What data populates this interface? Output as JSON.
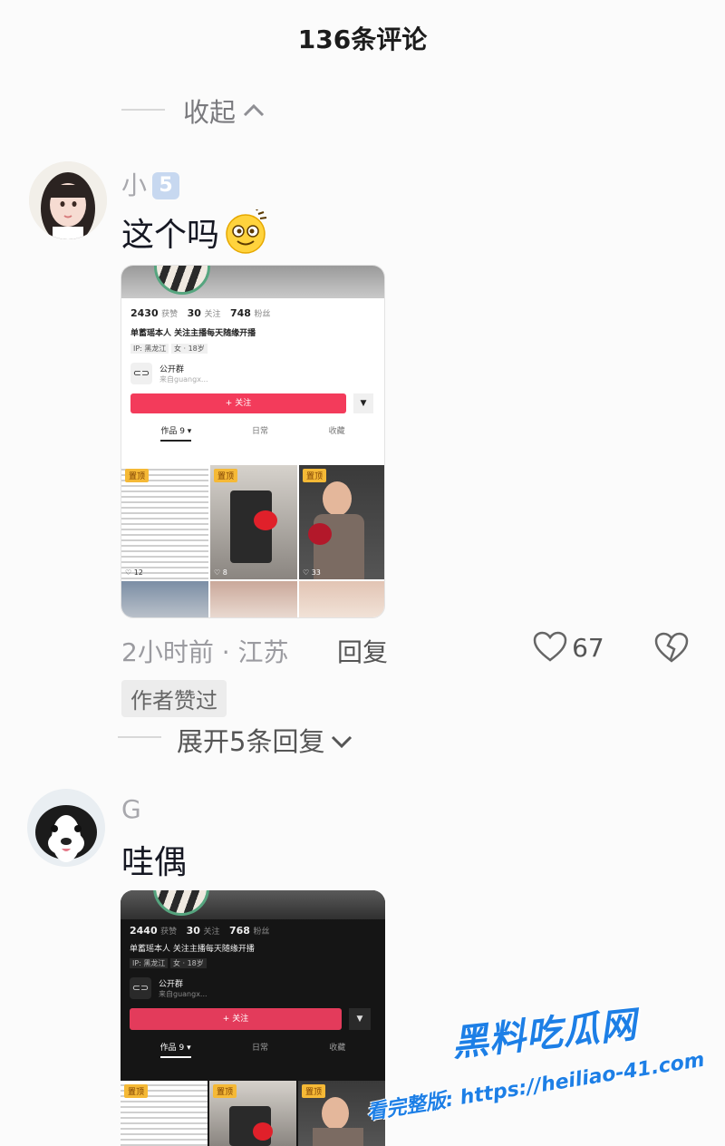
{
  "header": {
    "title": "136条评论"
  },
  "collapse": {
    "label": "收起"
  },
  "comments": [
    {
      "user": "小",
      "level": "5",
      "text": "这个吗",
      "time_location": "2小时前 · 江苏",
      "reply_label": "回复",
      "likes": "67",
      "author_liked_badge": "作者赞过",
      "expand_label": "展开5条回复",
      "screenshot": {
        "stats": [
          {
            "num": "2430",
            "label": "获赞"
          },
          {
            "num": "30",
            "label": "关注"
          },
          {
            "num": "748",
            "label": "粉丝"
          }
        ],
        "bio": "单蓄瑶本人 关注主播每天随缘开播",
        "ip": "IP: 黑龙江",
        "gender_age": "女 · 18岁",
        "group_title": "公开群",
        "group_sub": "来自guangx...",
        "follow_label": "+ 关注",
        "tabs": [
          "作品 9 ▾",
          "日常",
          "收藏"
        ],
        "tile_tag": "置顶",
        "tile_counts": [
          "12",
          "8",
          "33"
        ]
      }
    },
    {
      "user": "G",
      "text": "哇偶",
      "screenshot": {
        "stats": [
          {
            "num": "2440",
            "label": "获赞"
          },
          {
            "num": "30",
            "label": "关注"
          },
          {
            "num": "768",
            "label": "粉丝"
          }
        ],
        "bio": "单蓄瑶本人 关注主播每天随缘开播",
        "ip": "IP: 黑龙江",
        "gender_age": "女 · 18岁",
        "group_title": "公开群",
        "group_sub": "来自guangx...",
        "follow_label": "+ 关注",
        "tabs": [
          "作品 9 ▾",
          "日常",
          "收藏"
        ],
        "tile_tag": "置顶"
      }
    }
  ],
  "watermark": {
    "brand": "黑料吃瓜网",
    "url": "https://heiliao-41.com",
    "prefix": "看完整版:"
  },
  "colors": {
    "accent": "#fe2c55",
    "watermark": "#1d7fe6"
  }
}
